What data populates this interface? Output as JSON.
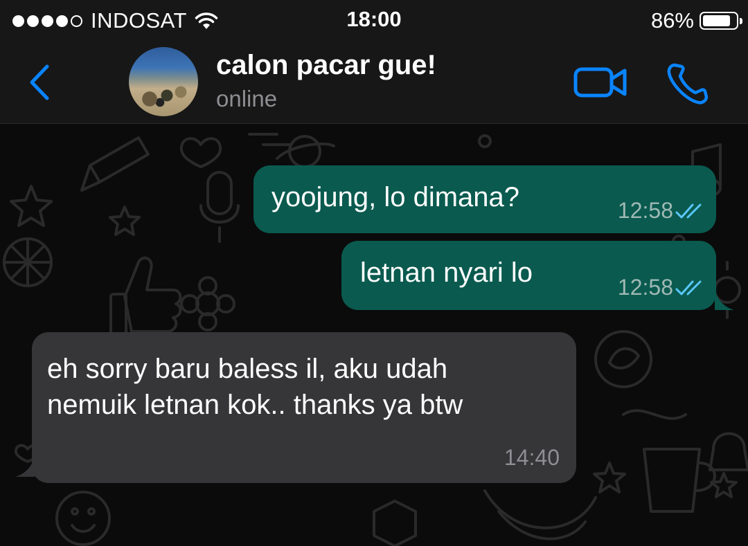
{
  "status_bar": {
    "carrier": "INDOSAT",
    "signal_bars": 4,
    "time": "18:00",
    "battery_percent_label": "86%",
    "battery_level": 0.86
  },
  "header": {
    "contact_name": "calon pacar gue!",
    "status": "online",
    "accent_color": "#0a84ff"
  },
  "messages": [
    {
      "direction": "outgoing",
      "text": "yoojung, lo dimana?",
      "time": "12:58",
      "read": true
    },
    {
      "direction": "outgoing",
      "text": "letnan nyari lo",
      "time": "12:58",
      "read": true
    },
    {
      "direction": "incoming",
      "text": "eh sorry baru baless il, aku udah\nnemuik letnan kok.. thanks ya btw",
      "time": "14:40"
    }
  ],
  "colors": {
    "outgoing_bubble": "#0a5a4f",
    "incoming_bubble": "#363638",
    "read_ticks": "#5ac8fa"
  }
}
